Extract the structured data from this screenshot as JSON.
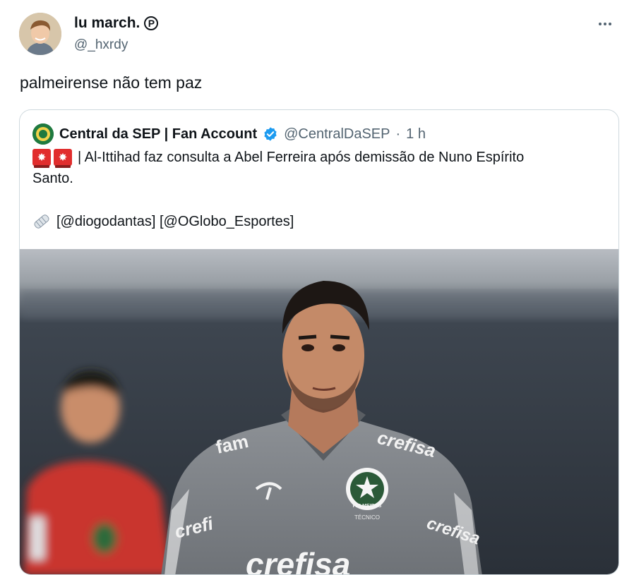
{
  "tweet": {
    "author": "lu march.",
    "author_badge": "ⓟ",
    "handle": "@_hxrdy",
    "text": "palmeirense não tem paz"
  },
  "quoted": {
    "name": "Central da SEP | Fan Account",
    "handle": "@CentralDaSEP",
    "separator": "·",
    "time": "1 h",
    "line1": "| Al-Ittihad faz consulta a Abel Ferreira após demissão de Nuno Espírito",
    "line2": "Santo.",
    "line3": "[@diogodantas] [@OGlobo_Esportes]",
    "verified_color": "#1d9bf0"
  },
  "photo_text": {
    "collar_logo": "fam",
    "sponsor_shoulder": "crefisa",
    "sponsor_sleeve": "crefi",
    "sponsor_sleeve_right": "crefisa",
    "sponsor_chest": "crefisa",
    "crest": "PALMEIRAS",
    "crest_sub": "TÉCNICO"
  }
}
